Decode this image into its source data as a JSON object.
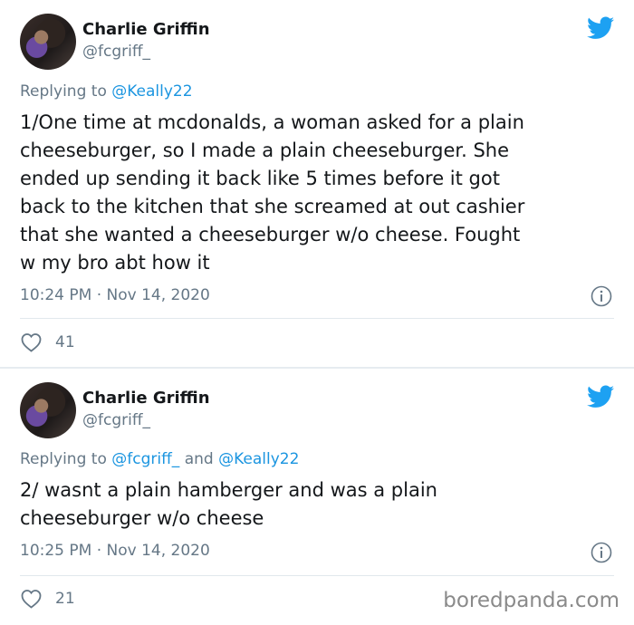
{
  "tweets": [
    {
      "author": {
        "display_name": "Charlie Griffin",
        "handle": "@fcgriff_",
        "avatar_icon": "profile-photo"
      },
      "replying_prefix": "Replying to ",
      "replying_to": "@Keally22",
      "text": "1/One time at mcdonalds, a woman asked for a plain\ncheeseburger, so I made a plain cheeseburger. She\nended up sending it back like 5 times before it got\nback to the kitchen that she screamed at out cashier\nthat she wanted a cheeseburger w/o cheese. Fought\nw my bro abt how it",
      "timestamp": "10:24 PM · Nov 14, 2020",
      "likes": "41"
    },
    {
      "author": {
        "display_name": "Charlie Griffin",
        "handle": "@fcgriff_",
        "avatar_icon": "profile-photo"
      },
      "replying_prefix": "Replying to ",
      "replying_to_1": "@fcgriff_",
      "replying_and": " and ",
      "replying_to_2": "@Keally22",
      "text": "2/ wasnt a plain hamberger and was a plain\ncheeseburger w/o cheese",
      "timestamp": "10:25 PM · Nov 14, 2020",
      "likes": "21"
    }
  ],
  "watermark": "boredpanda.com",
  "colors": {
    "twitter_blue": "#1da1f2",
    "mention": "#1b95e0",
    "secondary_text": "#657786"
  },
  "icons": [
    "twitter-logo-icon",
    "info-icon",
    "heart-icon"
  ]
}
